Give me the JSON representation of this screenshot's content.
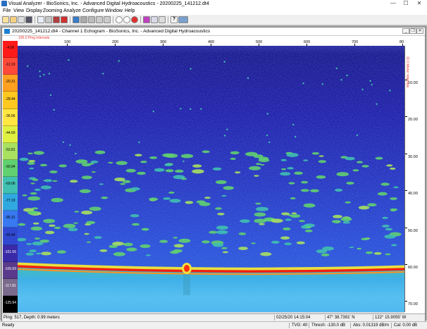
{
  "window": {
    "title": "Visual Analyzer - BioSonics, Inc. - Advanced Digital Hydroacoustics - 20200225_141212.dt4",
    "minimize": "—",
    "maximize": "☐",
    "close": "✕"
  },
  "menu": [
    "File",
    "View",
    "Display",
    "Zooming",
    "Analyze",
    "Configure",
    "Window",
    "Help"
  ],
  "toolbar_icons": [
    "open-file-icon",
    "open-folder-icon",
    "print-icon",
    "save-icon",
    "chart-icon",
    "grid-icon",
    "image-icon",
    "stop-icon",
    "list-icon",
    "table-icon",
    "bars-icon",
    "edit-icon",
    "zoom-in-icon",
    "zoom-out-icon",
    "no-entry-icon",
    "histogram-icon",
    "layers-icon",
    "arrow-icon",
    "help-icon",
    "settings-icon"
  ],
  "child": {
    "title": "20200225_141212.dt4 - Channel 1  Echogram - BioSonics, Inc. - Advanced Digital Hydroacoustics"
  },
  "ruler": {
    "label": "100.0 Ping Intervals",
    "ticks": [
      "100",
      "200",
      "300",
      "400",
      "500",
      "600",
      "700",
      "80"
    ]
  },
  "color_scale": {
    "labels": [
      "-4.06",
      "-12.19",
      "-20.31",
      "-28.44",
      "-36.56",
      "-44.69",
      "-52.81",
      "-60.94",
      "-69.06",
      "-77.19",
      "-85.31",
      "-93.44",
      "-101.56",
      "-109.69",
      "-117.81",
      "-125.94"
    ],
    "colors": [
      "#ff1a1a",
      "#ff4a3a",
      "#ffa020",
      "#ffc820",
      "#ffe640",
      "#e0f040",
      "#a8e060",
      "#60d070",
      "#40c0b0",
      "#30a8e0",
      "#3878f0",
      "#3048d0",
      "#3a2aa8",
      "#5a3a8a",
      "#7a6a8c",
      "#000000"
    ]
  },
  "depth_axis": {
    "label": "10.0 Meter Intervals",
    "ticks": [
      "10.00",
      "20.00",
      "30.00",
      "40.00",
      "50.00",
      "60.00",
      "70.00"
    ]
  },
  "child_status": {
    "ping": "Ping: 517, Depth: 0.99 meters",
    "datetime": "02/25/20 14:15:04",
    "lat": "47° 38.7391' N",
    "lon": "122° 15.9055' W"
  },
  "app_status": {
    "ready": "Ready",
    "tvg": "TVG: 40",
    "thresh": "Thresh: -130.0 dB",
    "abs": "Abs: 0.01319 dB/m",
    "cal": "Cal: 0.00 dB"
  }
}
